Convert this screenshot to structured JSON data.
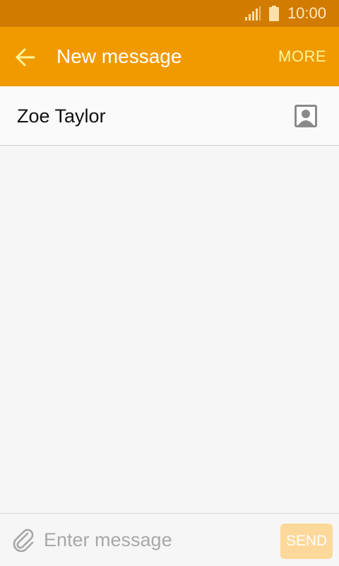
{
  "status_bar": {
    "time": "10:00",
    "signal_icon": "signal-bars-icon",
    "battery_icon": "battery-icon"
  },
  "app_bar": {
    "back_icon": "arrow-left-icon",
    "title": "New message",
    "more_label": "MORE"
  },
  "recipient": {
    "name": "Zoe Taylor",
    "contact_icon": "contact-card-icon"
  },
  "composer": {
    "attach_icon": "paperclip-icon",
    "placeholder": "Enter message",
    "value": "",
    "send_label": "SEND"
  },
  "colors": {
    "status_bar": "#d17b00",
    "app_bar": "#f09a00",
    "more_text": "#fff59a",
    "send_disabled": "#fcd89a",
    "background": "#f6f6f6"
  }
}
